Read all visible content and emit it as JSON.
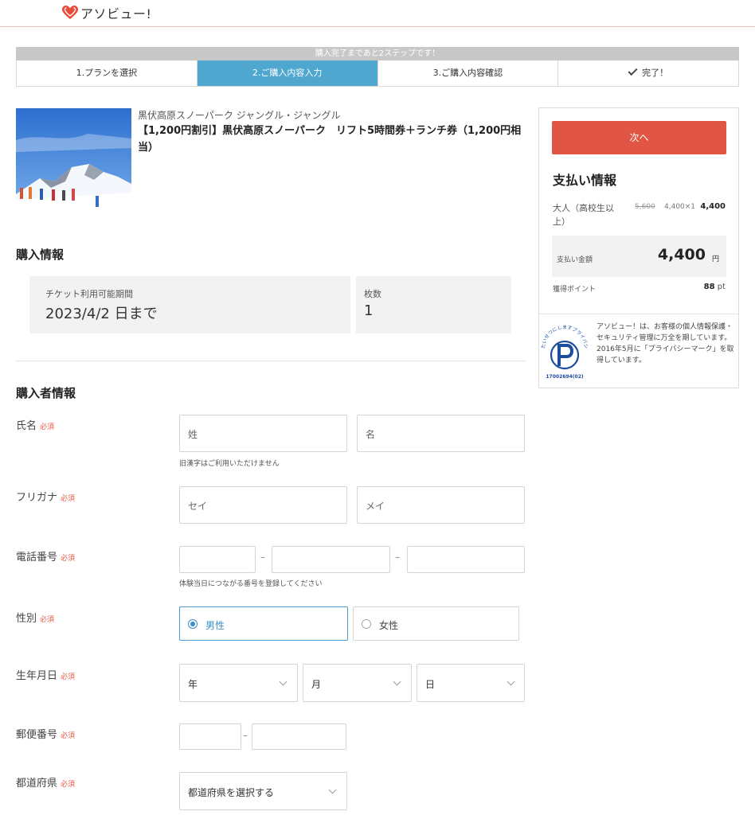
{
  "header": {
    "logo_text": "アソビュー!"
  },
  "steps": {
    "banner": "購入完了まであと2ステップです！",
    "items": [
      {
        "label": "1.プランを選択"
      },
      {
        "label": "2.ご購入内容入力"
      },
      {
        "label": "3.ご購入内容確認"
      },
      {
        "label": "完了！"
      }
    ],
    "active_index": 1
  },
  "product": {
    "subtitle": "黒伏高原スノーパーク ジャングル・ジャングル",
    "title": "【1,200円割引】黒伏高原スノーパーク　リフト5時間券＋ランチ券（1,200円相当）"
  },
  "purchase_info": {
    "title": "購入情報",
    "ticket_period_label": "チケット利用可能期間",
    "ticket_period_value": "2023/4/2 日まで",
    "qty_label": "枚数",
    "qty_value": "1"
  },
  "buyer": {
    "title": "購入者情報",
    "required": "必須",
    "name": {
      "label": "氏名",
      "last_ph": "姓",
      "first_ph": "名",
      "hint": "旧漢字はご利用いただけません"
    },
    "kana": {
      "label": "フリガナ",
      "last_ph": "セイ",
      "first_ph": "メイ"
    },
    "phone": {
      "label": "電話番号",
      "sep": "–",
      "hint": "体験当日につながる番号を登録してください"
    },
    "gender": {
      "label": "性別",
      "male": "男性",
      "female": "女性",
      "selected": "男性"
    },
    "birth": {
      "label": "生年月日",
      "year": "年",
      "month": "月",
      "day": "日"
    },
    "zip": {
      "label": "郵便番号",
      "sep": "–"
    },
    "pref": {
      "label": "都道府県",
      "placeholder": "都道府県を選択する"
    }
  },
  "sidebar": {
    "next_label": "次へ",
    "pay_title": "支払い情報",
    "adult_label": "大人（高校生以上）",
    "adult_orig": "5,600",
    "adult_unit": "4,400×1",
    "adult_amount": "4,400",
    "total_label": "支払い金額",
    "total_value": "4,400",
    "total_unit": "円",
    "points_label": "獲得ポイント",
    "points_value": "88",
    "points_unit": "pt",
    "privacy_text_1": "アソビュー！は、お客様の個人情報保護・セキュリティ管理に万全を期しています。",
    "privacy_text_2": "2016年5月に「プライバシーマーク」を取得しています。",
    "privacy_mark_top": "たいせつにしますプライバシー",
    "privacy_mark_id": "17002694(02)"
  },
  "colors": {
    "accent_blue": "#4fa6cf",
    "cta_red": "#e15545",
    "required_red": "#e35a45"
  }
}
